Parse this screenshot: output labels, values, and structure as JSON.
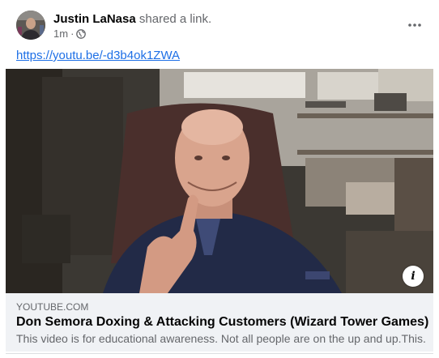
{
  "post": {
    "author_name": "Justin LaNasa",
    "action_text": "shared a link.",
    "timestamp": "1m",
    "separator": "·",
    "audience_icon": "globe-icon",
    "more_icon": "more-options-icon",
    "link_text": "https://youtu.be/-d3b4ok1ZWA"
  },
  "media": {
    "info_symbol": "i"
  },
  "preview": {
    "domain": "YOUTUBE.COM",
    "title": "Don Semora Doxing & Attacking Customers (Wizard Tower Games)",
    "description": "This video is for educational awareness. Not all people are on the up and up.This..."
  },
  "colors": {
    "link": "#1d6fe6",
    "secondary_text": "#65676b",
    "preview_bg": "#f0f2f5"
  }
}
